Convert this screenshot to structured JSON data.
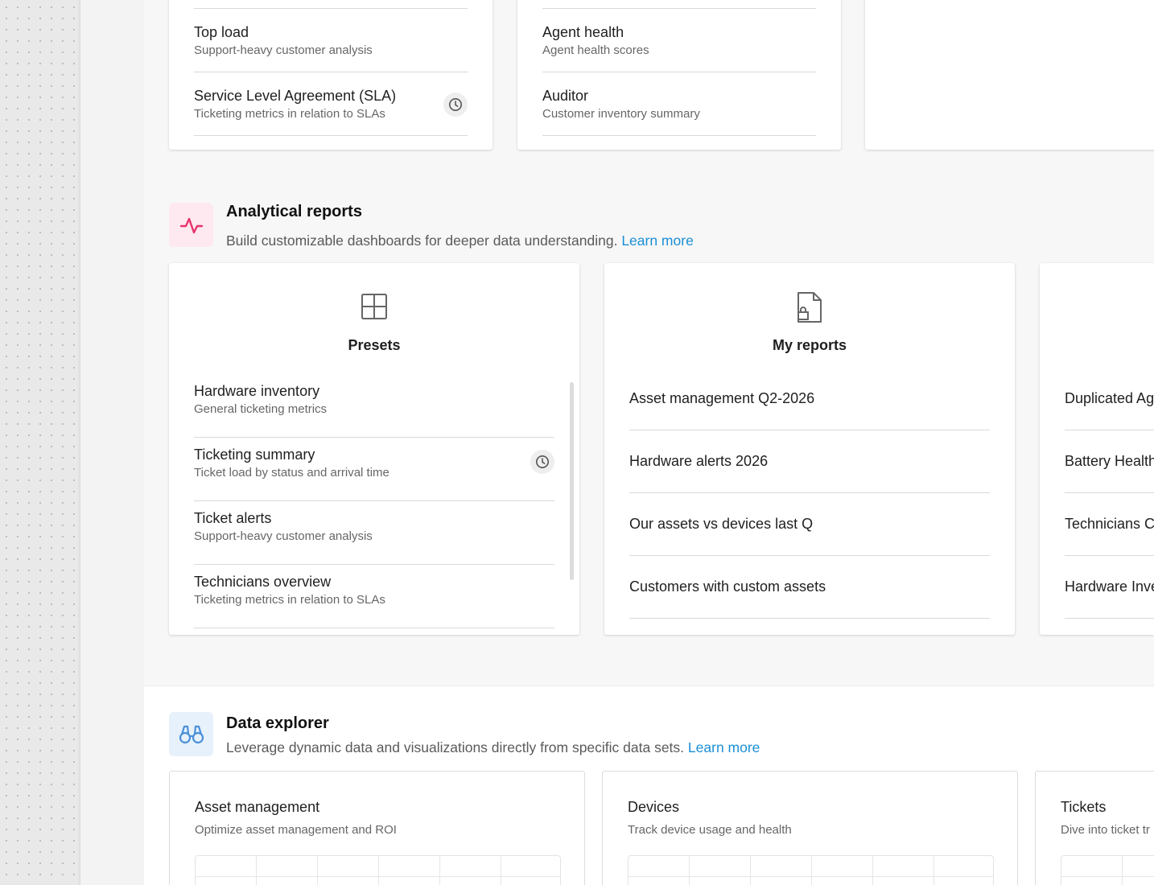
{
  "top_cards": {
    "left": {
      "items": [
        {
          "title": "Top load",
          "subtitle": "Support-heavy customer analysis"
        },
        {
          "title": "Service Level Agreement (SLA)",
          "subtitle": "Ticketing metrics in relation to SLAs"
        }
      ]
    },
    "middle": {
      "items": [
        {
          "title": "Agent health",
          "subtitle": "Agent health scores"
        },
        {
          "title": "Auditor",
          "subtitle": "Customer inventory summary"
        }
      ]
    }
  },
  "analytical": {
    "title": "Analytical reports",
    "description": "Build customizable dashboards for deeper data understanding.",
    "link": "Learn more",
    "icon": "activity-pulse-icon",
    "icon_color": "#e8336d",
    "icon_bg": "#fde9ef",
    "presets": {
      "label": "Presets",
      "icon": "grid-icon",
      "items": [
        {
          "title": "Hardware inventory",
          "subtitle": "General ticketing metrics"
        },
        {
          "title": "Ticketing summary",
          "subtitle": "Ticket load by status and arrival time"
        },
        {
          "title": "Ticket alerts",
          "subtitle": "Support-heavy customer analysis"
        },
        {
          "title": "Technicians overview",
          "subtitle": "Ticketing metrics in relation to SLAs"
        }
      ]
    },
    "my_reports": {
      "label": "My reports",
      "icon": "file-lock-icon",
      "items": [
        "Asset management Q2-2026",
        "Hardware alerts 2026",
        "Our assets vs devices last Q",
        "Customers with custom assets"
      ]
    },
    "third_card": {
      "items": [
        "Duplicated Ag",
        "Battery Health",
        "Technicians C",
        "Hardware Inve"
      ]
    }
  },
  "data_explorer": {
    "title": "Data explorer",
    "description": "Leverage dynamic data and visualizations directly from specific data sets.",
    "link": "Learn more",
    "icon": "binoculars-icon",
    "icon_color": "#4a90d9",
    "icon_bg": "#e7f1fb",
    "cards": [
      {
        "title": "Asset management",
        "subtitle": "Optimize asset management and ROI"
      },
      {
        "title": "Devices",
        "subtitle": "Track device usage and health"
      },
      {
        "title": "Tickets",
        "subtitle": "Dive into ticket tr"
      }
    ]
  },
  "colors": {
    "link": "#1a8fd6"
  }
}
